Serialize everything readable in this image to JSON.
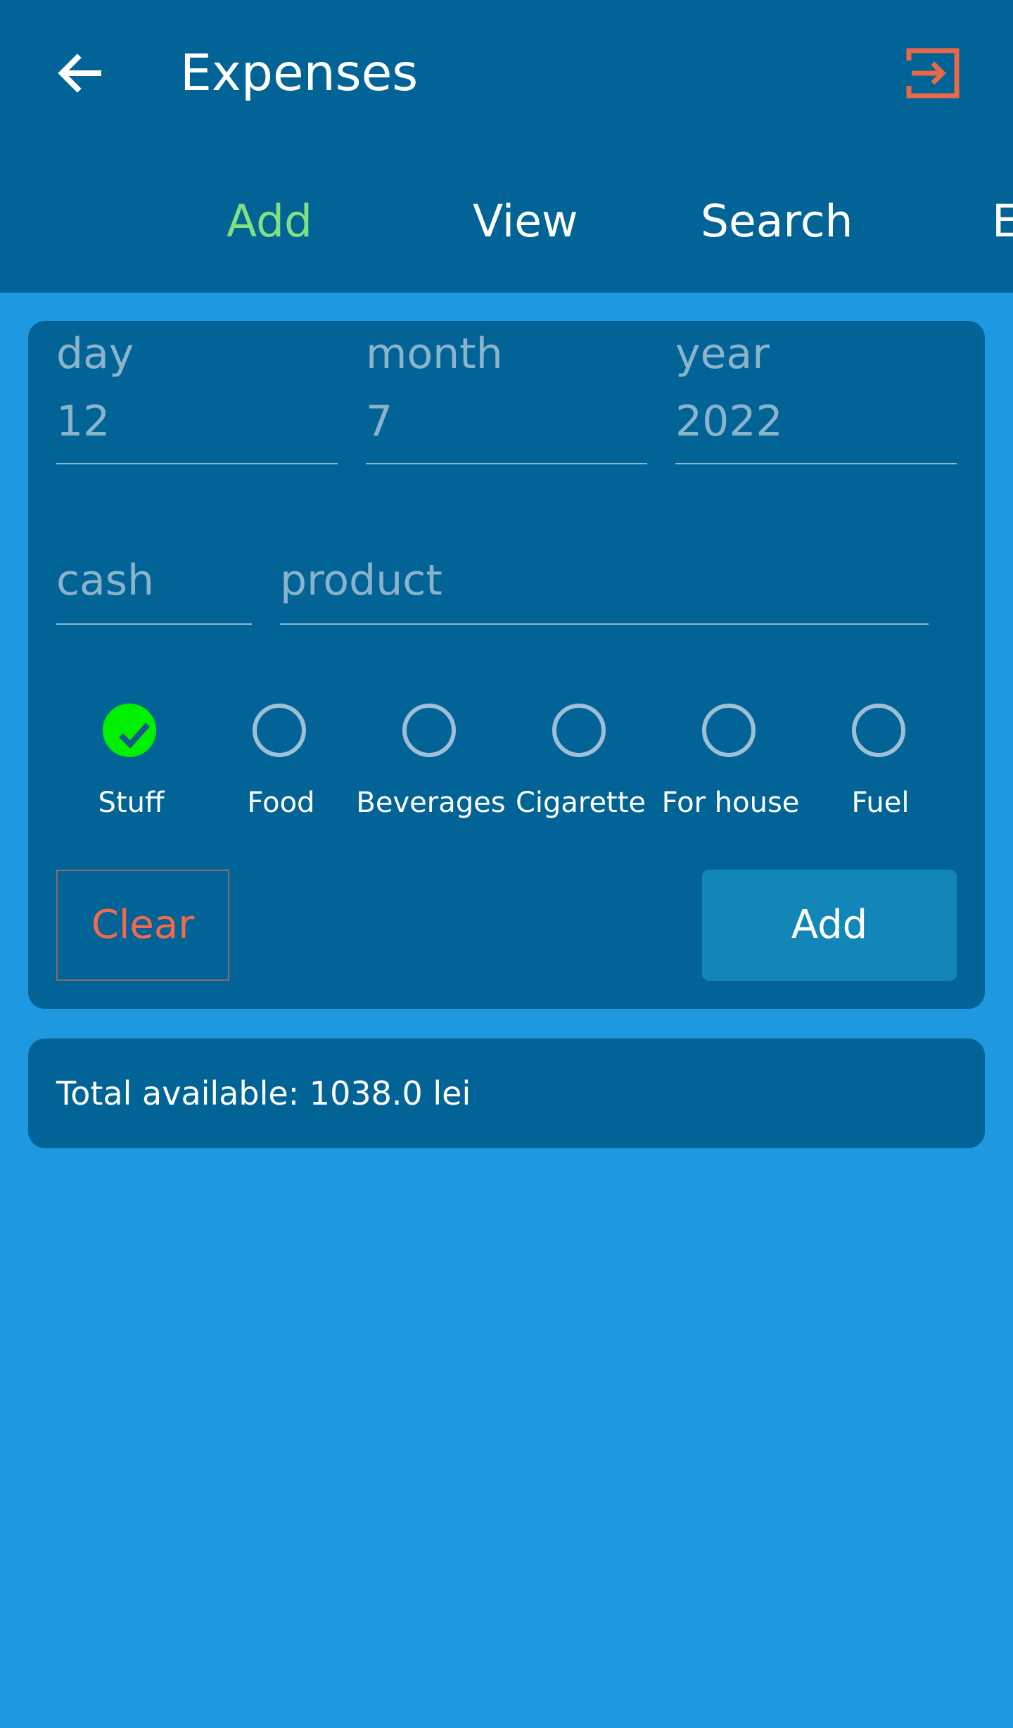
{
  "appbar": {
    "title": "Expenses",
    "back_icon": "arrow-left-icon",
    "exit_icon": "logout-icon"
  },
  "tabs": [
    {
      "label": "Add"
    },
    {
      "label": "View"
    },
    {
      "label": "Search"
    },
    {
      "label": "E"
    }
  ],
  "form": {
    "day": {
      "label": "day",
      "value": "12"
    },
    "month": {
      "label": "month",
      "value": "7"
    },
    "year": {
      "label": "year",
      "value": "2022"
    },
    "cash": {
      "label": "cash"
    },
    "product": {
      "label": "product"
    },
    "categories": [
      {
        "label": "Stuff",
        "checked": true
      },
      {
        "label": "Food",
        "checked": false
      },
      {
        "label": "Beverages",
        "checked": false
      },
      {
        "label": "Cigarette",
        "checked": false
      },
      {
        "label": "For house",
        "checked": false
      },
      {
        "label": "Fuel",
        "checked": false
      }
    ],
    "clear_label": "Clear",
    "add_label": "Add"
  },
  "summary": {
    "total_text": "Total available: 1038.0 lei"
  },
  "colors": {
    "background": "#1e98e0",
    "surface": "#026496",
    "active_tab": "#7fe17f",
    "accent_red": "#f26a4a",
    "checked_green": "#00f000",
    "add_button": "#1287b7"
  }
}
